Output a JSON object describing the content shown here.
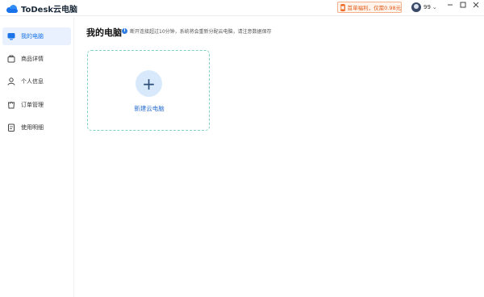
{
  "app": {
    "name": "ToDesk云电脑"
  },
  "header": {
    "promo_text": "首单福利，仅需0.98元",
    "promo_icon": "gift-icon",
    "user_name": "99",
    "window_controls": [
      "minimize",
      "maximize",
      "close"
    ]
  },
  "sidebar": {
    "items": [
      {
        "label": "我的电脑",
        "icon": "monitor-icon",
        "active": true
      },
      {
        "label": "商品详情",
        "icon": "product-icon",
        "active": false
      },
      {
        "label": "个人信息",
        "icon": "person-icon",
        "active": false
      },
      {
        "label": "订单管理",
        "icon": "order-icon",
        "active": false
      },
      {
        "label": "使用明细",
        "icon": "usage-icon",
        "active": false
      }
    ]
  },
  "main": {
    "title": "我的电脑",
    "notice": "断开连接超过10分钟，系统将会重新分配云电脑，请注意数据保存",
    "new_card_label": "新建云电脑"
  },
  "colors": {
    "accent": "#1a73e8",
    "active_bg": "#e8f1fd",
    "card_border": "#7fd1c6",
    "promo_orange": "#e05a18"
  }
}
